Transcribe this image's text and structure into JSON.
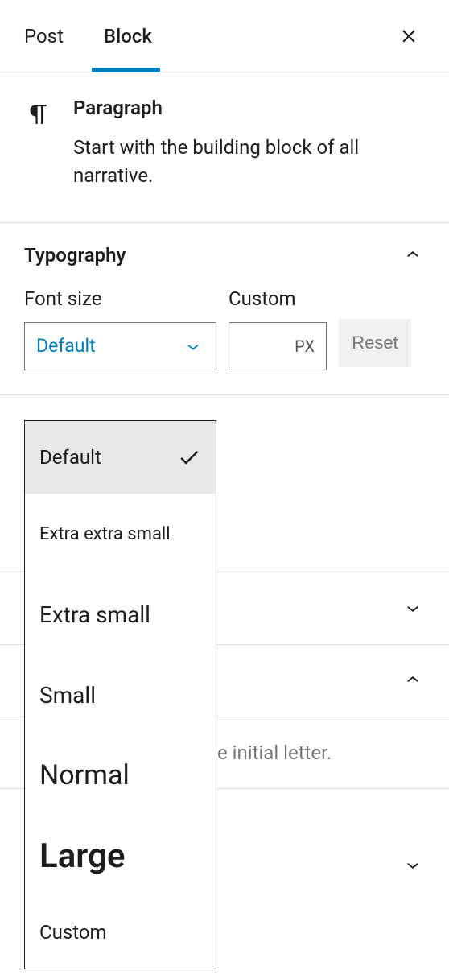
{
  "tabs": {
    "post": "Post",
    "block": "Block"
  },
  "block": {
    "title": "Paragraph",
    "description": "Start with the building block of all narrative."
  },
  "typography_section": {
    "title": "Typography",
    "font_size_label": "Font size",
    "custom_label": "Custom",
    "selected": "Default",
    "px_suffix": "PX",
    "reset": "Reset"
  },
  "font_size_options": {
    "default": "Default",
    "xxsmall": "Extra extra small",
    "xsmall": "Extra small",
    "small": "Small",
    "normal": "Normal",
    "large": "Large",
    "custom": "Custom"
  },
  "background_text": "e initial letter."
}
